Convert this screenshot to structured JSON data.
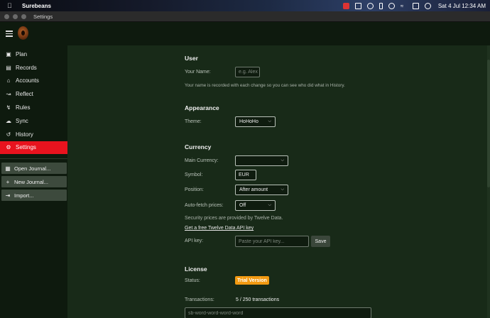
{
  "menubar": {
    "app_name": "Surebeans",
    "clock": "Sat 4 Jul  12:34 AM"
  },
  "window": {
    "title": "Settings"
  },
  "sidebar": {
    "items": [
      {
        "label": "Plan",
        "icon": "calendar-icon"
      },
      {
        "label": "Records",
        "icon": "list-icon"
      },
      {
        "label": "Accounts",
        "icon": "bank-icon"
      },
      {
        "label": "Reflect",
        "icon": "chart-icon"
      },
      {
        "label": "Rules",
        "icon": "rules-icon"
      },
      {
        "label": "Sync",
        "icon": "sync-icon"
      },
      {
        "label": "History",
        "icon": "history-icon"
      },
      {
        "label": "Settings",
        "icon": "gear-icon",
        "active": true
      }
    ],
    "actions": [
      {
        "label": "Open Journal...",
        "icon": "folder-icon"
      },
      {
        "label": "New Journal...",
        "icon": "plus-icon"
      },
      {
        "label": "Import...",
        "icon": "import-icon"
      }
    ]
  },
  "user": {
    "heading": "User",
    "name_label": "Your Name:",
    "name_placeholder": "e.g. Alex",
    "name_hint": "Your name is recorded with each change so you can see who did what in History."
  },
  "appearance": {
    "heading": "Appearance",
    "theme_label": "Theme:",
    "theme_value": "HoHoHo"
  },
  "currency": {
    "heading": "Currency",
    "main_label": "Main Currency:",
    "main_value": "",
    "symbol_label": "Symbol:",
    "symbol_value": "EUR",
    "position_label": "Position:",
    "position_value": "After amount",
    "autofetch_label": "Auto-fetch prices:",
    "autofetch_value": "Off",
    "provider_note": "Security prices are provided by Twelve Data.",
    "api_link": "Get a free Twelve Data API key",
    "api_label": "API key:",
    "api_placeholder": "Paste your API key...",
    "save_label": "Save"
  },
  "license": {
    "heading": "License",
    "status_label": "Status:",
    "status_value": "Trial Version",
    "transactions_label": "Transactions:",
    "transactions_value": "5 / 250 transactions",
    "key_placeholder": "sb-word-word-word-word"
  },
  "colors": {
    "accent": "#e8131e",
    "badge": "#f29a12",
    "background": "#182a18",
    "sidebar": "#0e1a0e"
  }
}
